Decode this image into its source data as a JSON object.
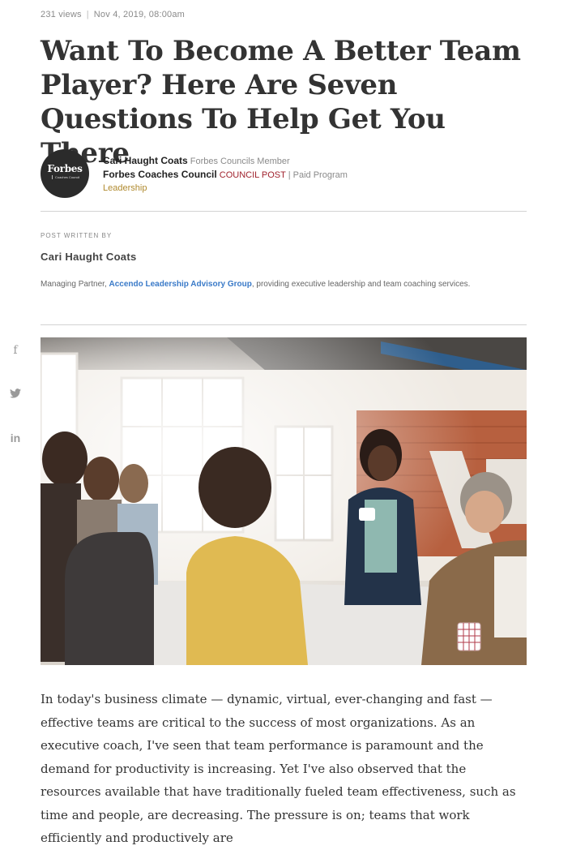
{
  "meta": {
    "views": "231 views",
    "separator": "|",
    "date": "Nov 4, 2019, 08:00am"
  },
  "headline": "Want To Become A Better Team Player? Here Are Seven Questions To Help Get You There",
  "logo": {
    "word": "Forbes",
    "sub": "Coaches Council"
  },
  "author": {
    "name": "Cari Haught Coats",
    "member_label": "Forbes Councils Member",
    "council": "Forbes Coaches Council",
    "post_type": "COUNCIL POST",
    "program": "| Paid Program",
    "category": "Leadership"
  },
  "post_written_by": {
    "label": "POST WRITTEN BY",
    "name": "Cari Haught Coats",
    "bio_prefix": "Managing Partner, ",
    "bio_link": "Accendo Leadership Advisory Group",
    "bio_suffix": ", providing executive leadership and team coaching services."
  },
  "share": [
    {
      "icon": "facebook-icon",
      "glyph": "f"
    },
    {
      "icon": "twitter-icon"
    },
    {
      "icon": "linkedin-icon",
      "glyph": "in"
    }
  ],
  "hero_image": {
    "icon": "photo-team-meeting"
  },
  "body": "In today's business climate — dynamic, virtual, ever-changing and fast — effective teams are critical to the success of most organizations. As an executive coach, I've seen that team performance is paramount and the demand for productivity is increasing. Yet I've also observed that the resources available that have traditionally fueled team effectiveness, such as time and people, are decreasing. The pressure is on; teams that work efficiently and productively are",
  "colors": {
    "council_post": "#a0222d",
    "leadership": "#b08a2e",
    "link": "#3a7ac8",
    "logo_bg": "#2b2b2b"
  }
}
